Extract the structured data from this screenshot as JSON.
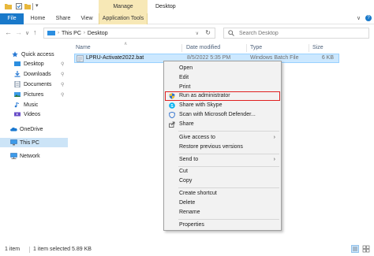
{
  "window": {
    "title": "Desktop",
    "contextual_tab": "Manage"
  },
  "ribbon": {
    "tabs": [
      "File",
      "Home",
      "Share",
      "View",
      "Application Tools"
    ]
  },
  "address": {
    "segments": [
      "This PC",
      "Desktop"
    ],
    "search_placeholder": "Search Desktop"
  },
  "sidebar": {
    "items": [
      {
        "label": "Quick access",
        "icon": "star-icon",
        "pinned": false
      },
      {
        "label": "Desktop",
        "icon": "desktop-folder-icon",
        "pinned": true
      },
      {
        "label": "Downloads",
        "icon": "downloads-folder-icon",
        "pinned": true
      },
      {
        "label": "Documents",
        "icon": "documents-folder-icon",
        "pinned": true
      },
      {
        "label": "Pictures",
        "icon": "pictures-folder-icon",
        "pinned": true
      },
      {
        "label": "Music",
        "icon": "music-folder-icon",
        "pinned": false
      },
      {
        "label": "Videos",
        "icon": "videos-folder-icon",
        "pinned": false
      },
      {
        "label": "OneDrive",
        "icon": "cloud-icon",
        "pinned": false
      },
      {
        "label": "This PC",
        "icon": "computer-icon",
        "pinned": false
      },
      {
        "label": "Network",
        "icon": "network-icon",
        "pinned": false
      }
    ],
    "selected": "This PC"
  },
  "file_list": {
    "columns": [
      "Name",
      "Date modified",
      "Type",
      "Size"
    ],
    "rows": [
      {
        "name": "LPRU-Activate2022.bat",
        "date": "8/5/2022 5:35 PM",
        "type": "Windows Batch File",
        "size": "6 KB"
      }
    ]
  },
  "context_menu": {
    "items": [
      {
        "label": "Open"
      },
      {
        "label": "Edit"
      },
      {
        "label": "Print"
      },
      {
        "label": "Run as administrator",
        "icon": "uac-shield-icon",
        "highlighted": true
      },
      {
        "label": "Share with Skype",
        "icon": "skype-icon"
      },
      {
        "label": "Scan with Microsoft Defender...",
        "icon": "defender-shield-icon"
      },
      {
        "label": "Share",
        "icon": "share-icon"
      },
      {
        "label": "Give access to",
        "submenu": true
      },
      {
        "label": "Restore previous versions"
      },
      {
        "label": "Send to",
        "submenu": true
      },
      {
        "label": "Cut"
      },
      {
        "label": "Copy"
      },
      {
        "label": "Create shortcut"
      },
      {
        "label": "Delete"
      },
      {
        "label": "Rename"
      },
      {
        "label": "Properties"
      }
    ]
  },
  "status": {
    "item_count": "1 item",
    "selection": "1 item selected  5.89 KB"
  },
  "colors": {
    "file_tab": "#1979ca",
    "selection": "#cce8ff",
    "highlight_border": "#e02020",
    "manage_tab": "#f7e8b6"
  }
}
